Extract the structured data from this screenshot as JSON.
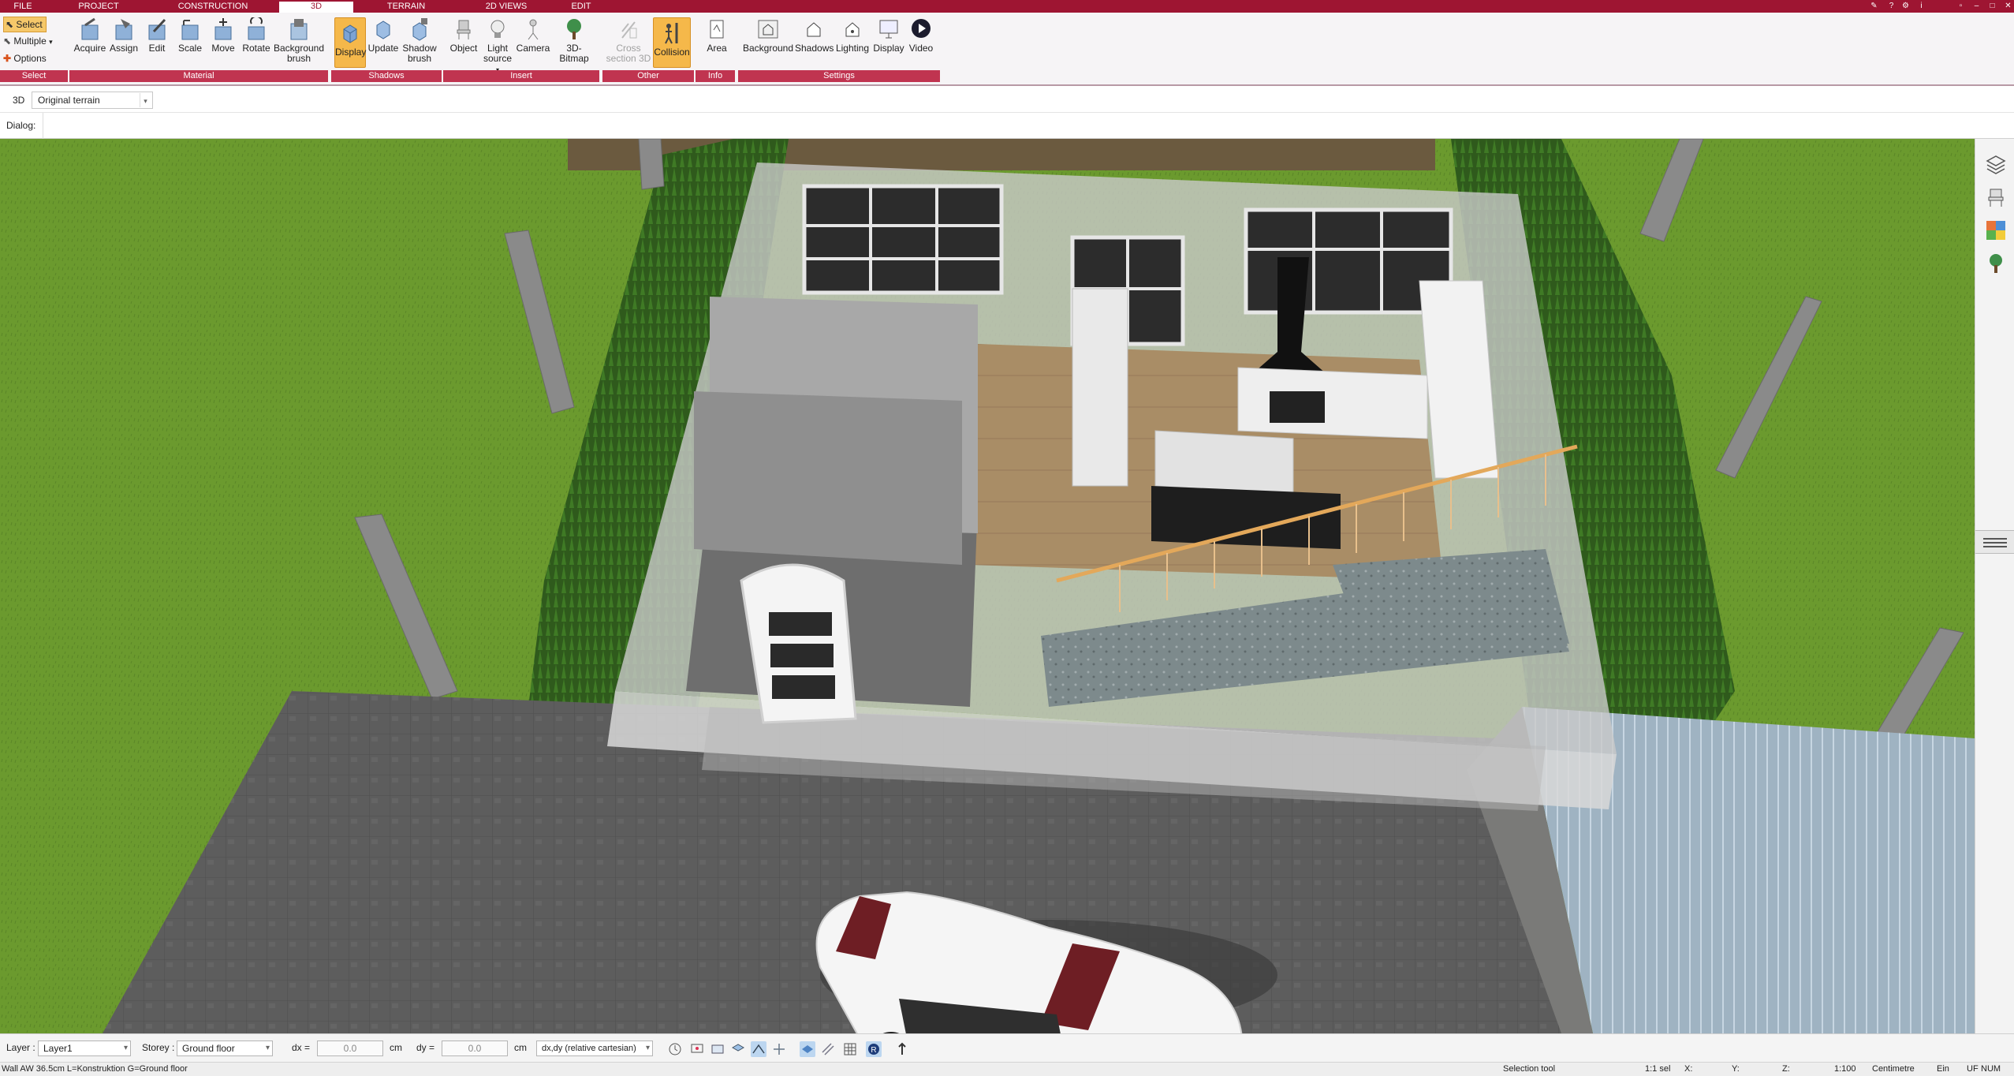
{
  "menu": {
    "tabs": [
      "FILE",
      "PROJECT",
      "CONSTRUCTION",
      "3D",
      "TERRAIN",
      "2D VIEWS",
      "EDIT"
    ],
    "active_tab": "3D"
  },
  "ribbon": {
    "select": {
      "select_label": "Select",
      "multiple_label": "Multiple",
      "options_label": "Options",
      "group_label": "Select"
    },
    "material": {
      "group_label": "Material",
      "acquire": "Acquire",
      "assign": "Assign",
      "edit": "Edit",
      "scale": "Scale",
      "move": "Move",
      "rotate": "Rotate",
      "background_brush_1": "Background",
      "background_brush_2": "brush"
    },
    "shadows": {
      "group_label": "Shadows",
      "display": "Display",
      "update": "Update",
      "shadow_brush_1": "Shadow",
      "shadow_brush_2": "brush"
    },
    "insert": {
      "group_label": "Insert",
      "object": "Object",
      "light_source_1": "Light",
      "light_source_2": "source",
      "camera": "Camera",
      "bitmap": "3D-Bitmap"
    },
    "other": {
      "group_label": "Other",
      "cross_section_1": "Cross",
      "cross_section_2": "section 3D",
      "collision": "Collision"
    },
    "info": {
      "group_label": "Info",
      "area": "Area"
    },
    "settings": {
      "group_label": "Settings",
      "background": "Background",
      "shadows": "Shadows",
      "lighting": "Lighting",
      "display": "Display",
      "video": "Video"
    }
  },
  "view_row": {
    "mode_label": "3D",
    "terrain_value": "Original terrain"
  },
  "dialog_row": {
    "label": "Dialog:"
  },
  "bottom": {
    "layer_label": "Layer :",
    "layer_value": "Layer1",
    "storey_label": "Storey :",
    "storey_value": "Ground floor",
    "dx_label": "dx =",
    "dx_value": "0.0",
    "dx_unit": "cm",
    "dy_label": "dy =",
    "dy_value": "0.0",
    "dy_unit": "cm",
    "coord_mode": "dx,dy (relative cartesian)"
  },
  "status": {
    "message": "Wall AW 36.5cm L=Konstruktion G=Ground floor",
    "tool": "Selection tool",
    "selection": "1:1 sel",
    "x_label": "X:",
    "y_label": "Y:",
    "z_label": "Z:",
    "scale": "1:100",
    "unit": "Centimetre",
    "ein": "Ein",
    "uf": "UF",
    "num": "NUM"
  },
  "colors": {
    "brand": "#9e1532",
    "group_bar": "#c03450",
    "active_button": "#f5b84a",
    "lawn": "#6b9a2e",
    "paving": "#5c5c5c"
  }
}
